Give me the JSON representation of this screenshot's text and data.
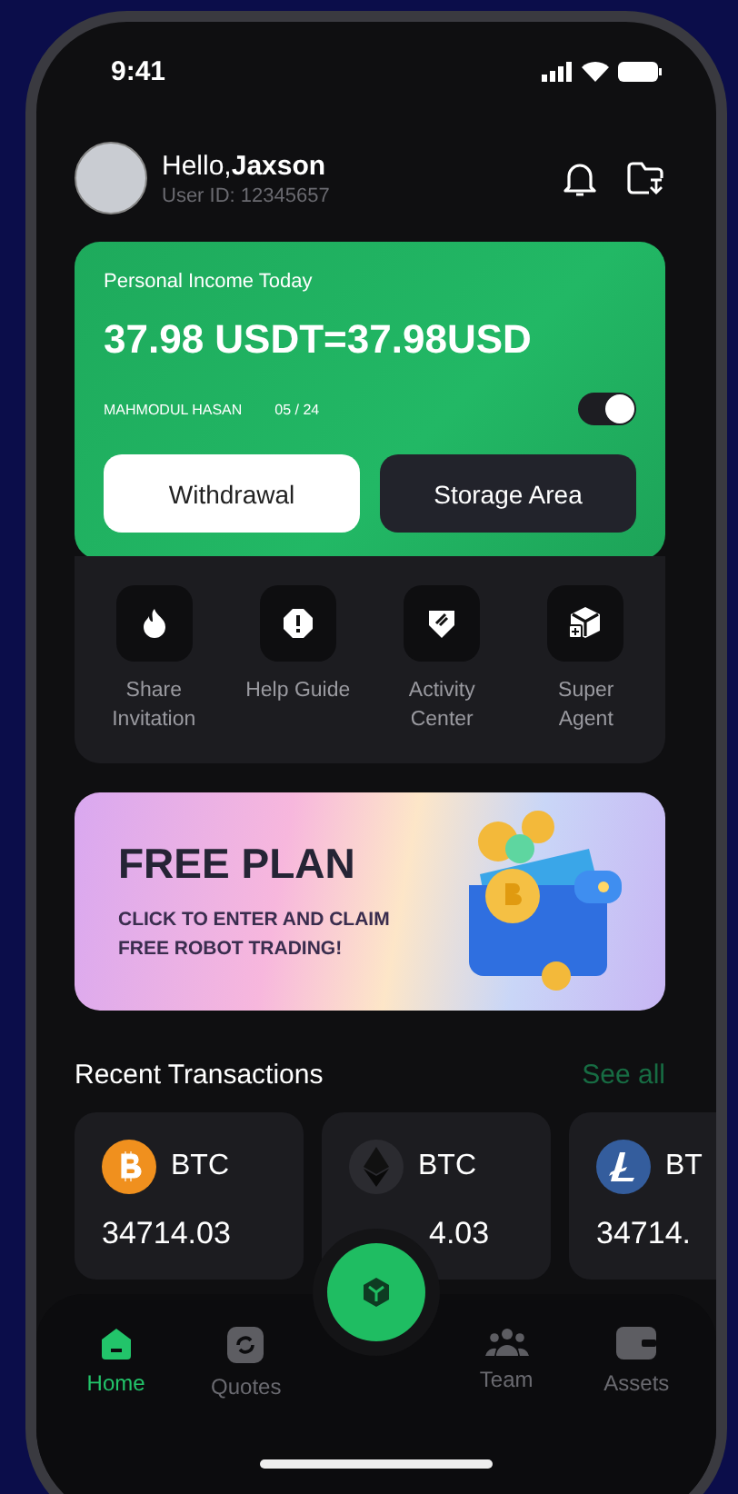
{
  "status_bar": {
    "time": "9:41"
  },
  "header": {
    "greeting_prefix": "Hello,",
    "name": "Jaxson",
    "user_id": "User ID: 12345657"
  },
  "income_card": {
    "title": "Personal Income Today",
    "amount": "37.98 USDT=37.98USD",
    "holder": "MAHMODUL HASAN",
    "date": "05 / 24",
    "toggle_on": true,
    "buttons": [
      {
        "label": "Withdrawal",
        "kind": "primary"
      },
      {
        "label": "Storage Area",
        "kind": "secondary"
      }
    ]
  },
  "shortcuts": [
    {
      "label": "Share Invitation",
      "kind": "flame"
    },
    {
      "label": "Help Guide",
      "kind": "alert"
    },
    {
      "label": "Activity Center",
      "kind": "badge"
    },
    {
      "label": "Super Agent",
      "kind": "cube"
    }
  ],
  "banner": {
    "title": "FREE PLAN",
    "subtitle": "CLICK TO ENTER AND CLAIM FREE ROBOT TRADING!"
  },
  "recent": {
    "title": "Recent Transactions",
    "see_all": "See all",
    "items": [
      {
        "coin": "BTC",
        "value": "34714.03",
        "kind": "bitcoin"
      },
      {
        "coin": "BTC",
        "value": "4.03",
        "kind": "ether"
      },
      {
        "coin": "BT",
        "value": "34714.",
        "kind": "litecoin"
      }
    ]
  },
  "nav": [
    {
      "label": "Home",
      "kind": "home",
      "selected": true
    },
    {
      "label": "Quotes",
      "kind": "quotes",
      "selected": false
    },
    {
      "label": "Team",
      "kind": "team",
      "selected": false
    },
    {
      "label": "Assets",
      "kind": "wallet",
      "selected": false
    }
  ]
}
